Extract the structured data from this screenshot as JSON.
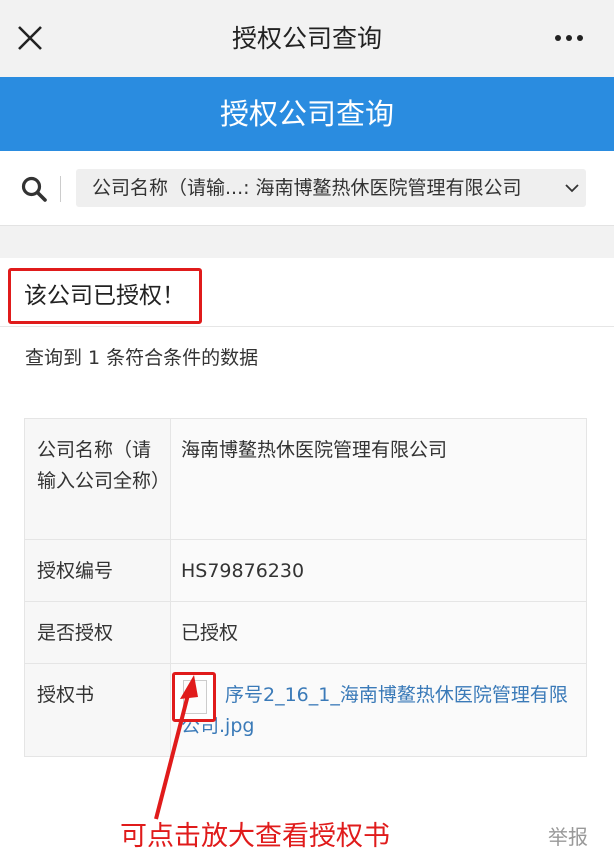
{
  "topbar": {
    "title": "授权公司查询"
  },
  "banner": {
    "title": "授权公司查询"
  },
  "search": {
    "field_text": "公司名称（请输...: 海南博鳌热休医院管理有限公司"
  },
  "result": {
    "headline": "该公司已授权！",
    "count_text": "查询到 1 条符合条件的数据",
    "rows": [
      {
        "label": "公司名称（请输入公司全称）",
        "value": "海南博鳌热休医院管理有限公司"
      },
      {
        "label": "授权编号",
        "value": "HS79876230"
      },
      {
        "label": "是否授权",
        "value": "已授权"
      },
      {
        "label": "授权书",
        "value": "序号2_16_1_海南博鳌热休医院管理有限公司.jpg"
      }
    ]
  },
  "callout": "可点击放大查看授权书",
  "report": "举报",
  "colors": {
    "accent": "#2a8ce0",
    "highlight": "#e01b1b",
    "link": "#3a7ab8"
  }
}
